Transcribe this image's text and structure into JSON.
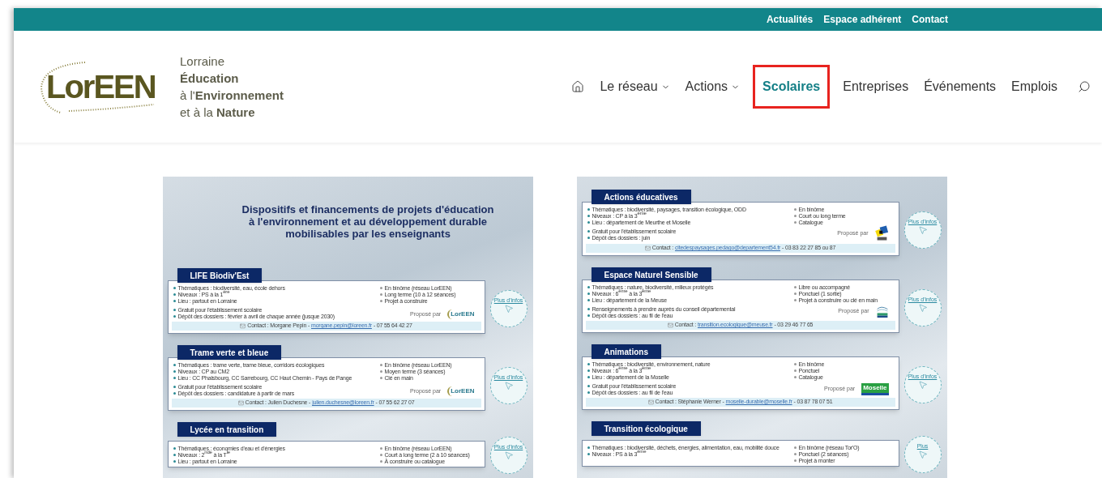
{
  "top_links": [
    {
      "label": "Actualités"
    },
    {
      "label": "Espace adhérent"
    },
    {
      "label": "Contact"
    }
  ],
  "logo": {
    "wordmark": "Lor**EEN**",
    "tagline": [
      "Lorraine",
      "**Éducation**",
      "à l'**Environnement**",
      "et à la **Nature**"
    ]
  },
  "nav": [
    {
      "kind": "home",
      "selected": false,
      "highlighted": false
    },
    {
      "kind": "link",
      "label": "Le réseau",
      "has_menu": true,
      "selected": false,
      "highlighted": false
    },
    {
      "kind": "link",
      "label": "Actions",
      "has_menu": true,
      "selected": false,
      "highlighted": false
    },
    {
      "kind": "link",
      "label": "Scolaires",
      "has_menu": false,
      "selected": true,
      "highlighted": true
    },
    {
      "kind": "link",
      "label": "Entreprises",
      "has_menu": false,
      "selected": false,
      "highlighted": false
    },
    {
      "kind": "link",
      "label": "Événements",
      "has_menu": false,
      "selected": false,
      "highlighted": false
    },
    {
      "kind": "link",
      "label": "Emplois",
      "has_menu": false,
      "selected": false,
      "highlighted": false
    },
    {
      "kind": "search",
      "selected": false,
      "highlighted": false
    }
  ],
  "posters": [
    {
      "heading": [
        "Dispositifs et financements de projets d'éducation",
        "à l'environnement et au développement durable",
        "mobilisables par les enseignants"
      ],
      "cards": [
        {
          "title": "LIFE Biodiv'Est",
          "details": [
            "Thématiques : biodiversité, eau, école dehors",
            "Niveaux : PS à la 1$^{ère}$",
            "Lieu : partout en Lorraine"
          ],
          "conditions": [
            "Gratuit pour l'établissement scolaire",
            "Dépôt des dossiers : février à avril de chaque année (jusque 2030)"
          ],
          "format": [
            "En binôme (réseau LorEEN)",
            "Long terme (10 à 12 séances)",
            "Projet à construire"
          ],
          "proposed_by": "Proposé par",
          "partner": {
            "kind": "loreen",
            "text": "LorEEN"
          },
          "contact": {
            "label": "Contact : Morgane Pepin -",
            "email": "morgane.pepin@loreen.fr",
            "phone": "- 07 55 64 42 27"
          },
          "more": "Plus d'infos"
        },
        {
          "title": "Trame verte et bleue",
          "details": [
            "Thématiques : trame verte, trame bleue, corridors écologiques",
            "Niveaux : CP au CM2",
            "Lieu : CC Phalsbourg, CC Sarrebourg, CC Haut Chemin - Pays de Pange"
          ],
          "conditions": [
            "Gratuit pour l'établissement scolaire",
            "Dépôt des dossiers : candidature à partir de mars"
          ],
          "format": [
            "En binôme (réseau LorEEN)",
            "Moyen terme (3 séances)",
            "Clé en main"
          ],
          "proposed_by": "Proposé par",
          "partner": {
            "kind": "loreen",
            "text": "LorEEN"
          },
          "contact": {
            "label": "Contact : Julien Duchesne -",
            "email": "julien.duchesne@loreen.fr",
            "phone": "- 07 55 62 27 07"
          },
          "more": "Plus d'infos"
        },
        {
          "title": "Lycée en transition",
          "details": [
            "Thématiques : économies d'eau et d'énergies",
            "Niveaux : 2$^{nde}$ à la T$^{le}$",
            "Lieu : partout en Lorraine"
          ],
          "format": [
            "En binôme (réseau LorEEN)",
            "Court à long terme (2 à 10 séances)",
            "À construire ou catalogue"
          ],
          "more": "Plus d'infos"
        }
      ]
    },
    {
      "cards": [
        {
          "title": "Actions éducatives",
          "details": [
            "Thématiques : biodiversité, paysages, transition écologique, ODD",
            "Niveaux : CP à la 3$^{ème}$",
            "Lieu : département de Meurthe et Moselle"
          ],
          "conditions": [
            "Gratuit pour l'établissement scolaire",
            "Dépôt des dossiers : juin"
          ],
          "format": [
            "En binôme",
            "Court ou long terme",
            "Catalogue"
          ],
          "proposed_by": "Proposé par",
          "partner": {
            "kind": "squares"
          },
          "contact": {
            "label": "Contact :",
            "email": "citedespaysages.pedago@departement54.fr",
            "phone": "- 03 83 22 27 85 ou 87"
          },
          "more": "Plus d'infos"
        },
        {
          "title": "Espace Naturel Sensible",
          "details": [
            "Thématiques : nature, biodiversité, milieux protégés",
            "Niveaux : 6$^{ème}$ à la 3$^{ème}$",
            "Lieu : département de la Meuse"
          ],
          "conditions": [
            "Renseignements à prendre auprès du conseil départemental",
            "Dépôt des dossiers : au fil de l'eau"
          ],
          "format": [
            "Libre ou accompagné",
            "Ponctuel (1 sortie)",
            "Projet à construire ou clé en main"
          ],
          "proposed_by": "Proposé par",
          "partner": {
            "kind": "waves"
          },
          "contact": {
            "label": "Contact :",
            "email": "transition.ecologique@meuse.fr",
            "phone": "- 03 29 46 77 65"
          },
          "more": "Plus d'infos"
        },
        {
          "title": "Animations",
          "details": [
            "Thématiques : biodiversité, environnement, nature",
            "Niveaux : 6$^{ème}$ à la 3$^{ème}$",
            "Lieu : département de la Moselle"
          ],
          "conditions": [
            "Gratuit pour l'établissement scolaire",
            "Dépôt des dossiers : au fil de l'eau"
          ],
          "format": [
            "En binôme",
            "Ponctuel",
            "Catalogue"
          ],
          "proposed_by": "Proposé par",
          "partner": {
            "kind": "badge",
            "text": "Moselle"
          },
          "contact": {
            "label": "Contact : Stéphanie Werner -",
            "email": "moselle-durable@moselle.fr",
            "phone": "- 03 87 78 07 51"
          },
          "more": "Plus d'infos"
        },
        {
          "title": "Transition écologique",
          "details": [
            "Thématiques : biodiversité, déchets, énergies, alimentation, eau, mobilité douce",
            "Niveaux : PS à la 3$^{ème}$"
          ],
          "format": [
            "En binôme (réseau Tor'O)",
            "Ponctuel (2 séances)",
            "Projet à monter"
          ],
          "more": "Plus"
        }
      ]
    }
  ]
}
